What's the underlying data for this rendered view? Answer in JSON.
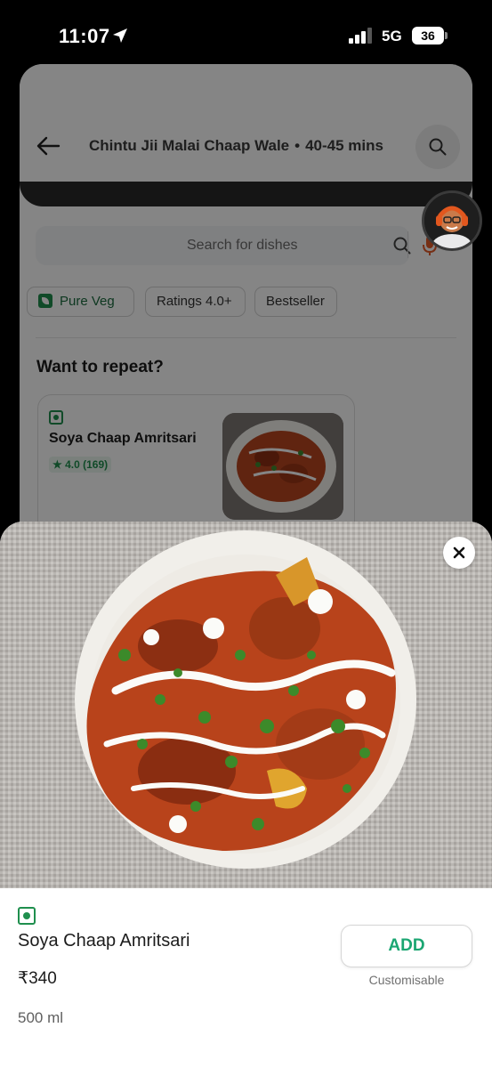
{
  "status_bar": {
    "time": "11:07",
    "network": "5G",
    "battery": "36"
  },
  "header": {
    "restaurant": "Chintu Jii Malai Chaap Wale",
    "separator": "•",
    "delivery_time": "40-45 mins"
  },
  "search": {
    "placeholder": "Search for dishes"
  },
  "filters": {
    "pure_veg": "Pure Veg",
    "ratings": "Ratings 4.0+",
    "bestseller": "Bestseller"
  },
  "repeat_section": {
    "title": "Want to repeat?",
    "item_name": "Soya Chaap Amritsari",
    "item_rating": "★ 4.0 (169)"
  },
  "dish_sheet": {
    "name": "Soya Chaap Amritsari",
    "price": "₹340",
    "quantity": "500 ml",
    "add_label": "ADD",
    "customisable_label": "Customisable"
  },
  "colors": {
    "accent_green": "#1ba672",
    "veg_green": "#1f8f4e"
  },
  "icons": [
    "location-arrow-icon",
    "signal-icon",
    "back-arrow-icon",
    "search-icon",
    "mic-icon",
    "close-icon",
    "veg-icon",
    "avatar"
  ]
}
